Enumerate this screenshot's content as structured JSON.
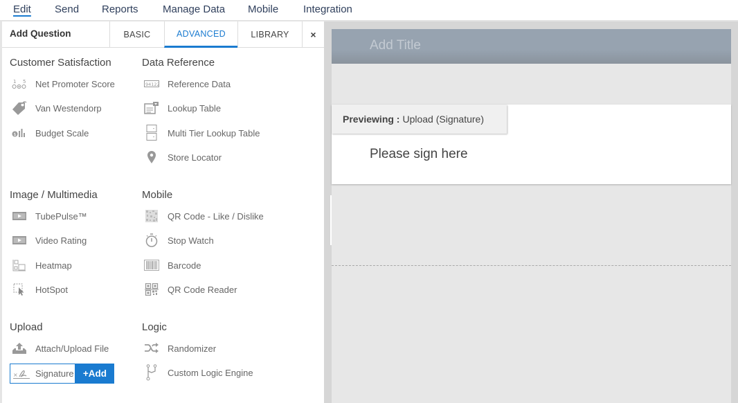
{
  "topnav": {
    "items": [
      {
        "label": "Edit",
        "active": true
      },
      {
        "label": "Send"
      },
      {
        "label": "Reports"
      },
      {
        "label": "Manage Data"
      },
      {
        "label": "Mobile"
      },
      {
        "label": "Integration"
      }
    ]
  },
  "panel": {
    "title": "Add Question",
    "tabs": [
      {
        "label": "BASIC"
      },
      {
        "label": "ADVANCED",
        "active": true
      },
      {
        "label": "LIBRARY"
      }
    ],
    "close_icon": "×",
    "accent_color": "#1a7bd0",
    "categories": [
      {
        "heading": "Customer Satisfaction",
        "items": [
          {
            "label": "Net Promoter Score",
            "icon": "nps-icon"
          },
          {
            "label": "Van Westendorp",
            "icon": "price-tag-icon"
          },
          {
            "label": "Budget Scale",
            "icon": "budget-scale-icon"
          }
        ]
      },
      {
        "heading": "Data Reference",
        "items": [
          {
            "label": "Reference Data",
            "icon": "reference-data-icon"
          },
          {
            "label": "Lookup Table",
            "icon": "lookup-table-icon"
          },
          {
            "label": "Multi Tier Lookup Table",
            "icon": "multi-tier-lookup-icon"
          },
          {
            "label": "Store Locator",
            "icon": "map-pin-icon"
          }
        ]
      },
      {
        "heading": "Image / Multimedia",
        "items": [
          {
            "label": "TubePulse™",
            "icon": "video-icon"
          },
          {
            "label": "Video Rating",
            "icon": "video-icon"
          },
          {
            "label": "Heatmap",
            "icon": "heatmap-icon"
          },
          {
            "label": "HotSpot",
            "icon": "hotspot-icon"
          }
        ]
      },
      {
        "heading": "Mobile",
        "items": [
          {
            "label": "QR Code - Like / Dislike",
            "icon": "qr-code-icon"
          },
          {
            "label": "Stop Watch",
            "icon": "stopwatch-icon"
          },
          {
            "label": "Barcode",
            "icon": "barcode-icon"
          },
          {
            "label": "QR Code Reader",
            "icon": "qr-reader-icon"
          }
        ]
      },
      {
        "heading": "Upload",
        "items": [
          {
            "label": "Attach/Upload File",
            "icon": "upload-icon"
          },
          {
            "label": "Signature",
            "icon": "signature-icon",
            "selected": true
          }
        ]
      },
      {
        "heading": "Logic",
        "items": [
          {
            "label": "Randomizer",
            "icon": "shuffle-icon"
          },
          {
            "label": "Custom Logic Engine",
            "icon": "logic-branch-icon"
          }
        ]
      }
    ],
    "add_button_label": "+Add"
  },
  "canvas": {
    "title_placeholder": "Add Title",
    "preview_label": "Previewing :",
    "preview_value": "Upload (Signature)",
    "question_text": "Please sign here"
  }
}
